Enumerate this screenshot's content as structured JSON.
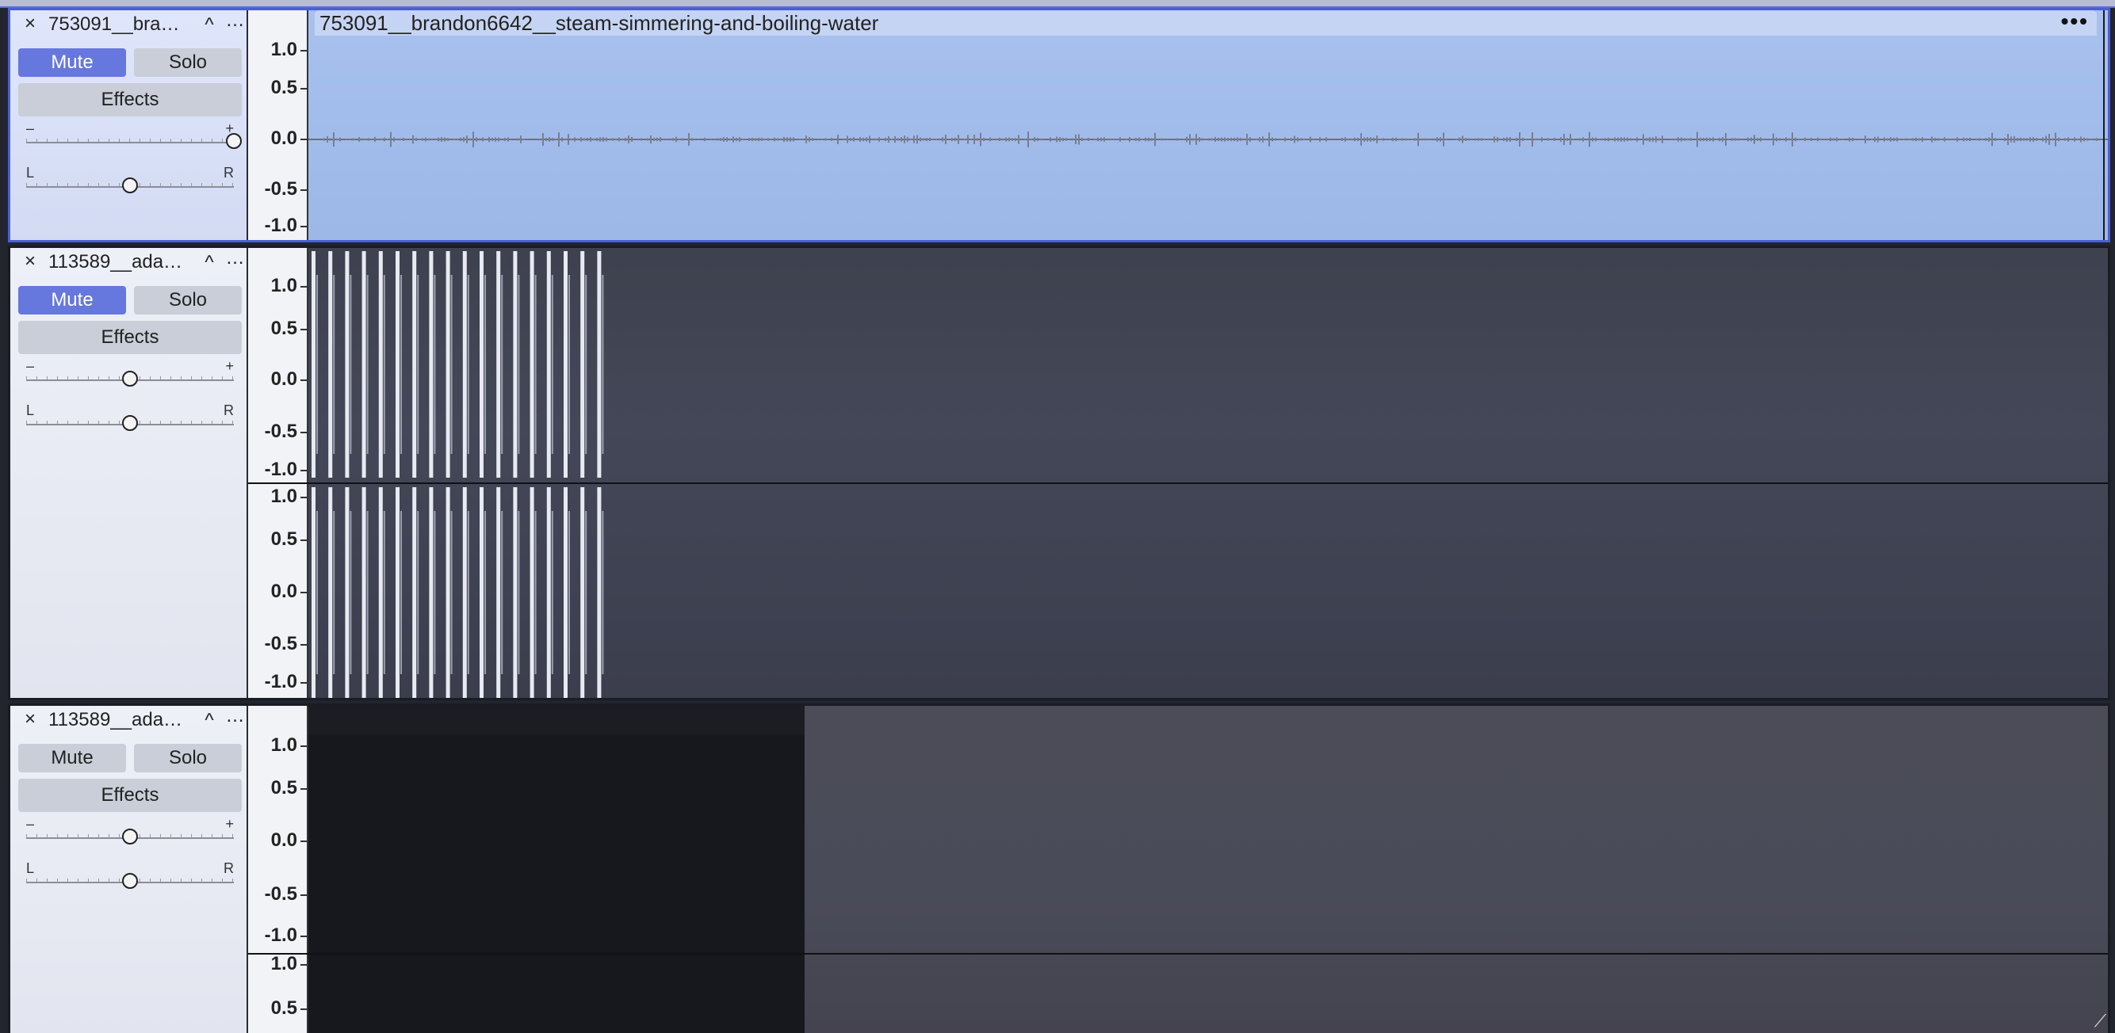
{
  "tracks": [
    {
      "name": "753091__bra…",
      "clip_title": "753091__brandon6642__steam-simmering-and-boiling-water",
      "mute_label": "Mute",
      "solo_label": "Solo",
      "effects_label": "Effects",
      "mute_active": true,
      "gain_minus": "–",
      "gain_plus": "+",
      "pan_left": "L",
      "pan_right": "R",
      "scale": [
        "1.0",
        "0.5",
        "0.0",
        "-0.5",
        "-1.0"
      ]
    },
    {
      "name": "113589__ada…",
      "mute_label": "Mute",
      "solo_label": "Solo",
      "effects_label": "Effects",
      "mute_active": true,
      "gain_minus": "–",
      "gain_plus": "+",
      "pan_left": "L",
      "pan_right": "R",
      "scale_top": [
        "1.0",
        "0.5",
        "0.0",
        "-0.5",
        "-1.0"
      ],
      "scale_bottom": [
        "1.0",
        "0.5",
        "0.0",
        "-0.5",
        "-1.0"
      ]
    },
    {
      "name": "113589__ada…",
      "mute_label": "Mute",
      "solo_label": "Solo",
      "effects_label": "Effects",
      "mute_active": false,
      "gain_minus": "–",
      "gain_plus": "+",
      "pan_left": "L",
      "pan_right": "R",
      "scale_top": [
        "1.0",
        "0.5",
        "0.0",
        "-0.5",
        "-1.0"
      ],
      "scale_bottom": [
        "1.0",
        "0.5"
      ]
    }
  ],
  "icons": {
    "close": "×",
    "collapse": "^",
    "menu": "…",
    "clip_menu": "•••"
  },
  "colors": {
    "selected_border": "#4a5fd6",
    "mute_on": "#6677dd",
    "wave_selected_bg": "#a2bceb"
  }
}
